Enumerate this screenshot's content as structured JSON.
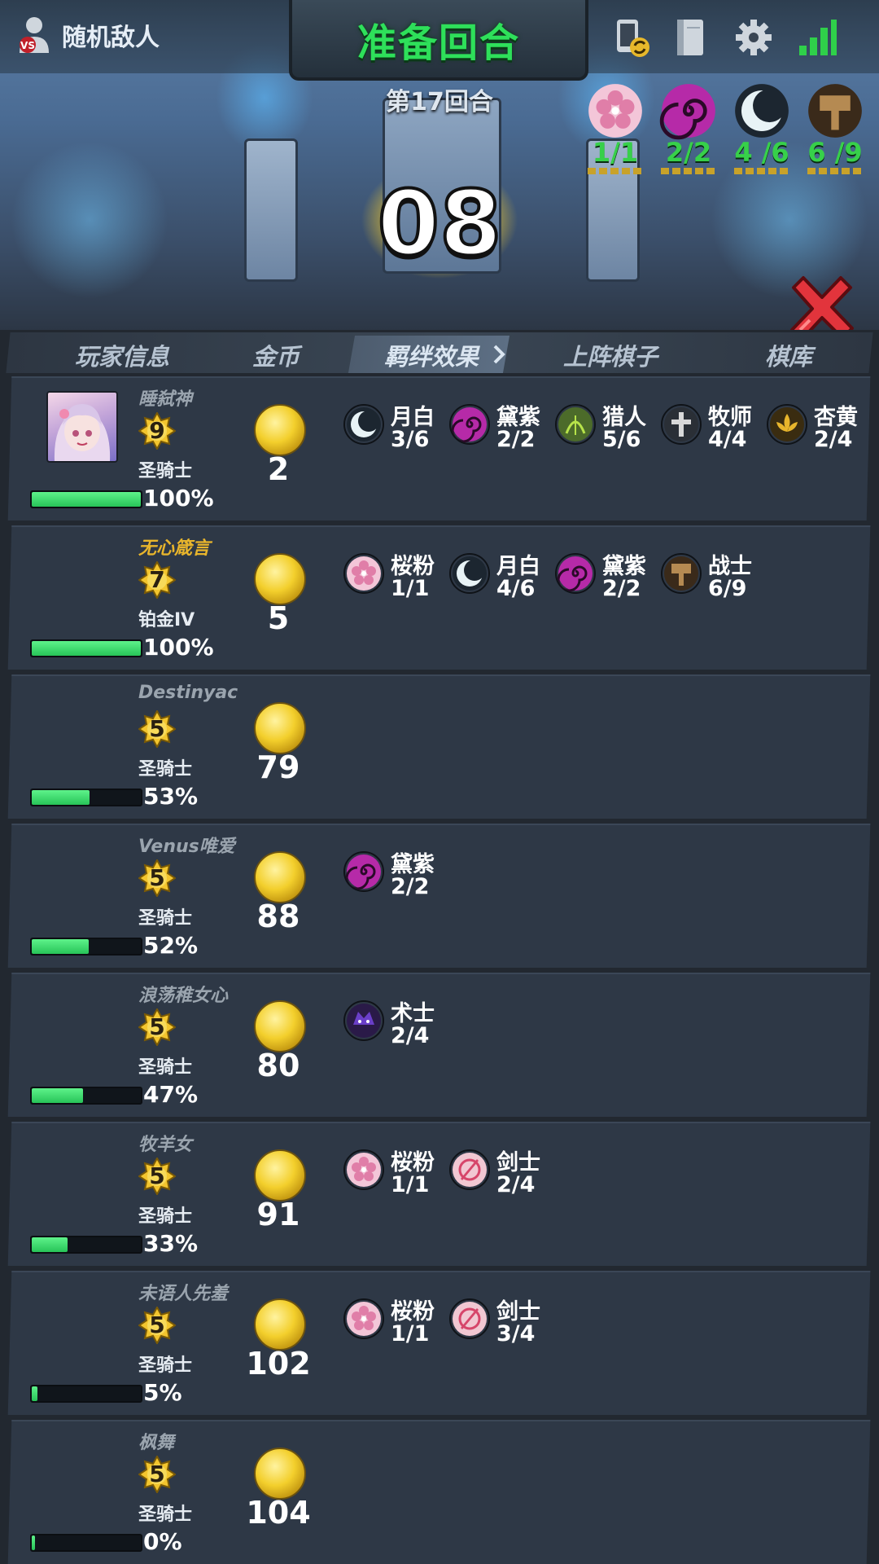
{
  "header": {
    "enemy_label": "随机敌人",
    "title": "准备回合",
    "round": "第17回合",
    "timer": "08"
  },
  "top_synergies": [
    {
      "icon": "sakura-icon",
      "color": "#e07ea8",
      "count": "1/1",
      "count_color": "#37d04a"
    },
    {
      "icon": "swirl-icon",
      "color": "#b62aa8",
      "count": "2/2",
      "count_color": "#37d04a"
    },
    {
      "icon": "moon-icon",
      "color": "#e8f3f6",
      "count": "4 /6",
      "count_color": "#37d04a"
    },
    {
      "icon": "hammer-icon",
      "color": "#b58a52",
      "count": "6 /9",
      "count_color": "#37d04a"
    }
  ],
  "tabs": [
    "玩家信息",
    "金币",
    "羁绊效果",
    "上阵棋子",
    "棋库"
  ],
  "players": [
    {
      "name": "睡弑神",
      "name_highlight": false,
      "level": "9",
      "rank": "圣骑士",
      "hp": 1.0,
      "hp_text": "100%",
      "gold": "2",
      "has_avatar": true,
      "bonds": [
        {
          "name": "月白",
          "count": "3/6",
          "icon": "moon-icon",
          "color": "#e8f3f6"
        },
        {
          "name": "黛紫",
          "count": "2/2",
          "icon": "swirl-icon",
          "color": "#b62aa8"
        },
        {
          "name": "猎人",
          "count": "5/6",
          "icon": "bow-icon",
          "color": "#4c6b2a"
        },
        {
          "name": "牧师",
          "count": "4/4",
          "icon": "cross-icon",
          "color": "#d8d8d8"
        },
        {
          "name": "杏黄",
          "count": "2/4",
          "icon": "lotus-icon",
          "color": "#e8b52c"
        }
      ]
    },
    {
      "name": "无心箴言",
      "name_highlight": true,
      "level": "7",
      "rank": "铂金IV",
      "hp": 1.0,
      "hp_text": "100%",
      "gold": "5",
      "has_avatar": false,
      "bonds": [
        {
          "name": "桜粉",
          "count": "1/1",
          "icon": "sakura-icon",
          "color": "#e07ea8"
        },
        {
          "name": "月白",
          "count": "4/6",
          "icon": "moon-icon",
          "color": "#e8f3f6"
        },
        {
          "name": "黛紫",
          "count": "2/2",
          "icon": "swirl-icon",
          "color": "#b62aa8"
        },
        {
          "name": "战士",
          "count": "6/9",
          "icon": "hammer-icon",
          "color": "#b58a52"
        }
      ]
    },
    {
      "name": "Destinyac",
      "name_highlight": false,
      "level": "5",
      "rank": "圣骑士",
      "hp": 0.53,
      "hp_text": "53%",
      "gold": "79",
      "has_avatar": false,
      "bonds": []
    },
    {
      "name": "Venus唯爱",
      "name_highlight": false,
      "level": "5",
      "rank": "圣骑士",
      "hp": 0.52,
      "hp_text": "52%",
      "gold": "88",
      "has_avatar": false,
      "bonds": [
        {
          "name": "黛紫",
          "count": "2/2",
          "icon": "swirl-icon",
          "color": "#b62aa8"
        }
      ]
    },
    {
      "name": "浪荡稚女心",
      "name_highlight": false,
      "level": "5",
      "rank": "圣骑士",
      "hp": 0.47,
      "hp_text": "47%",
      "gold": "80",
      "has_avatar": false,
      "bonds": [
        {
          "name": "术士",
          "count": "2/4",
          "icon": "warlock-icon",
          "color": "#6a3fc8"
        }
      ]
    },
    {
      "name": "牧羊女",
      "name_highlight": false,
      "level": "5",
      "rank": "圣骑士",
      "hp": 0.33,
      "hp_text": "33%",
      "gold": "91",
      "has_avatar": false,
      "bonds": [
        {
          "name": "桜粉",
          "count": "1/1",
          "icon": "sakura-icon",
          "color": "#e07ea8"
        },
        {
          "name": "剑士",
          "count": "2/4",
          "icon": "sword-icon",
          "color": "#d6456a"
        }
      ]
    },
    {
      "name": "未语人先羞",
      "name_highlight": false,
      "level": "5",
      "rank": "圣骑士",
      "hp": 0.05,
      "hp_text": "5%",
      "gold": "102",
      "has_avatar": false,
      "bonds": [
        {
          "name": "桜粉",
          "count": "1/1",
          "icon": "sakura-icon",
          "color": "#e07ea8"
        },
        {
          "name": "剑士",
          "count": "3/4",
          "icon": "sword-icon",
          "color": "#d6456a"
        }
      ]
    },
    {
      "name": "枫舞",
      "name_highlight": false,
      "level": "5",
      "rank": "圣骑士",
      "hp": 0.0,
      "hp_text": "0%",
      "gold": "104",
      "has_avatar": false,
      "bonds": []
    }
  ]
}
